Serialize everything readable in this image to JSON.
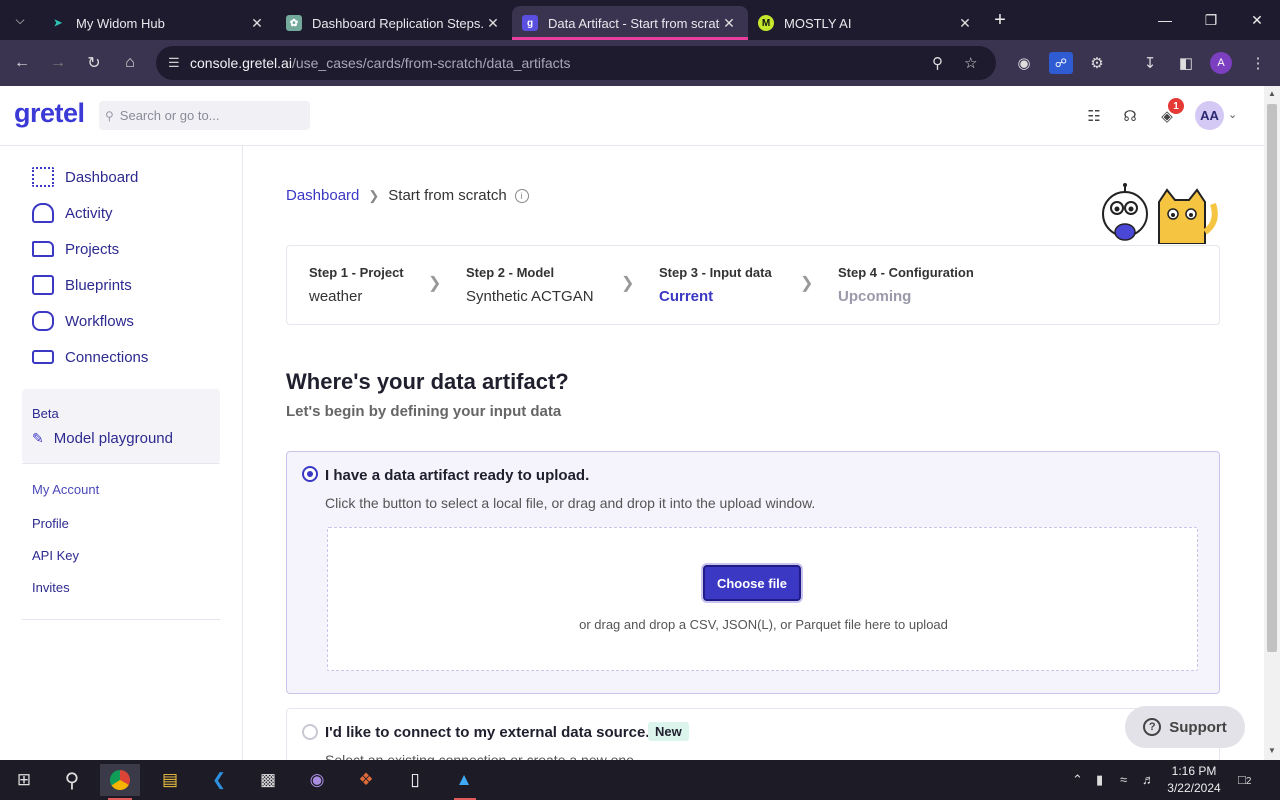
{
  "browser": {
    "tabs": [
      {
        "title": "My Widom Hub",
        "active": false
      },
      {
        "title": "Dashboard Replication Steps.",
        "active": false
      },
      {
        "title": "Data Artifact - Start from scratch",
        "active": true
      },
      {
        "title": "MOSTLY AI",
        "active": false
      }
    ],
    "url": {
      "host": "console.gretel.ai",
      "path": "/use_cases/cards/from-scratch/data_artifacts"
    },
    "profile_initial": "A"
  },
  "header": {
    "logo": "gretel",
    "search_placeholder": "Search or go to...",
    "notification_count": "1",
    "avatar_initials": "AA"
  },
  "sidebar": {
    "items": [
      {
        "label": "Dashboard",
        "icon": "grid-icon"
      },
      {
        "label": "Activity",
        "icon": "activity-icon"
      },
      {
        "label": "Projects",
        "icon": "folder-icon"
      },
      {
        "label": "Blueprints",
        "icon": "blueprint-icon"
      },
      {
        "label": "Workflows",
        "icon": "workflow-icon"
      },
      {
        "label": "Connections",
        "icon": "connection-icon"
      }
    ],
    "beta": {
      "label": "Beta",
      "item": "Model playground"
    },
    "account": {
      "heading": "My Account",
      "links": [
        "Profile",
        "API Key",
        "Invites"
      ]
    }
  },
  "breadcrumb": {
    "root": "Dashboard",
    "current": "Start from scratch"
  },
  "steps": [
    {
      "title": "Step 1 - Project",
      "value": "weather",
      "state": "done"
    },
    {
      "title": "Step 2 - Model",
      "value": "Synthetic ACTGAN",
      "state": "done"
    },
    {
      "title": "Step 3 - Input data",
      "value": "Current",
      "state": "current"
    },
    {
      "title": "Step 4 - Configuration",
      "value": "Upcoming",
      "state": "upcoming"
    }
  ],
  "main": {
    "heading": "Where's your data artifact?",
    "subheading": "Let's begin by defining your input data",
    "option_upload": {
      "label": "I have a data artifact ready to upload.",
      "description": "Click the button to select a local file, or drag and drop it into the upload window.",
      "button": "Choose file",
      "drop_hint": "or drag and drop a CSV, JSON(L), or Parquet file here to upload"
    },
    "option_connect": {
      "label": "I'd like to connect to my external data source.",
      "badge": "New",
      "description": "Select an existing connection or create a new one."
    }
  },
  "support_label": "Support",
  "taskbar": {
    "time": "1:16 PM",
    "date": "3/22/2024",
    "notifications": "2"
  }
}
